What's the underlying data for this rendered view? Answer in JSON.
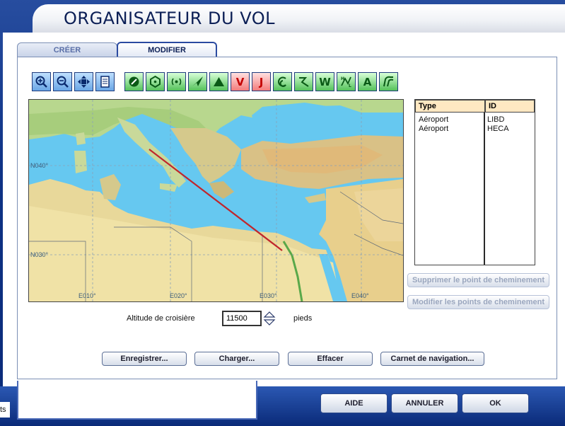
{
  "window": {
    "title": "ORGANISATEUR DU VOL"
  },
  "tabs": [
    {
      "label": "CRÉER"
    },
    {
      "label": "MODIFIER"
    }
  ],
  "toolbar": {
    "buttons": [
      {
        "label": ""
      },
      {
        "label": ""
      },
      {
        "label": ""
      },
      {
        "label": ""
      },
      {
        "label": ""
      },
      {
        "label": ""
      },
      {
        "label": ""
      },
      {
        "label": ""
      },
      {
        "label": ""
      },
      {
        "label": "V"
      },
      {
        "label": "J"
      },
      {
        "label": ""
      },
      {
        "label": ""
      },
      {
        "label": "W"
      },
      {
        "label": ""
      },
      {
        "label": "A"
      },
      {
        "label": ""
      }
    ]
  },
  "map": {
    "labels": {
      "n040": "N040°",
      "n030": "N030°",
      "e010": "E010°",
      "e020": "E020°",
      "e030": "E030°",
      "e040": "E040°"
    }
  },
  "waypoints": {
    "headers": {
      "type": "Type",
      "id": "ID"
    },
    "rows": [
      {
        "type": "Aéroport",
        "id": "LIBD"
      },
      {
        "type": "Aéroport",
        "id": "HECA"
      }
    ]
  },
  "side_buttons": {
    "delete_waypoint": "Supprimer le point de cheminement",
    "edit_waypoints": "Modifier les points de cheminement"
  },
  "cruise": {
    "label": "Altitude de croisière",
    "value": "11500",
    "unit": "pieds"
  },
  "actions": {
    "save": "Enregistrer...",
    "load": "Charger...",
    "clear": "Effacer",
    "navlog": "Carnet de navigation..."
  },
  "footer": {
    "help": "AIDE",
    "cancel": "ANNULER",
    "ok": "OK",
    "left_fragment": "ts"
  },
  "colors": {
    "frame_blue": "#0f3386",
    "route_red": "#c0262c",
    "sea_blue": "#66c8f0"
  }
}
